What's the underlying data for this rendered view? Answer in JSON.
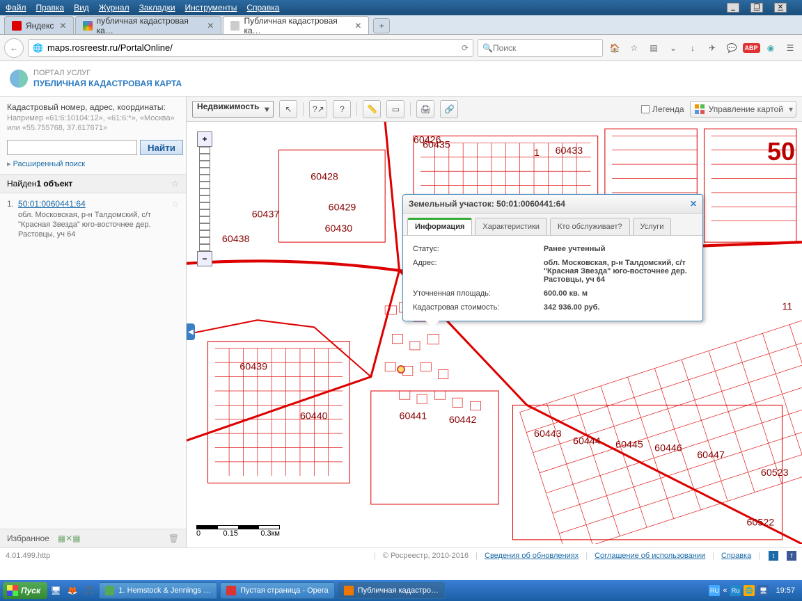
{
  "menu": {
    "file": "Файл",
    "edit": "Правка",
    "view": "Вид",
    "history": "Журнал",
    "bookmarks": "Закладки",
    "tools": "Инструменты",
    "help": "Справка"
  },
  "tabs": {
    "t1": "Яндекс",
    "t2": "публичная кадастровая ка…",
    "t3": "Публичная кадастровая ка…"
  },
  "url": "maps.rosreestr.ru/PortalOnline/",
  "search_placeholder": "Поиск",
  "portal": {
    "t1": "ПОРТАЛ УСЛУГ",
    "t2": "ПУБЛИЧНАЯ КАДАСТРОВАЯ КАРТА"
  },
  "sidebar": {
    "heading": "Кадастровый номер, адрес, координаты:",
    "hint": "Например «61:6:10104:12», «61:6:*», «Москва» или «55.755768, 37.617671»",
    "find": "Найти",
    "ext": "Расширенный поиск",
    "found_prefix": "Найден ",
    "found_count": "1 объект",
    "result": {
      "num": "1.",
      "cad": "50:01:0060441:64",
      "addr": "обл. Московская, р-н Талдомский, с/т \"Красная Звезда\" юго-восточнее дер. Растовцы, уч 64"
    },
    "fav": "Избранное"
  },
  "toolbar": {
    "realty": "Недвижимость",
    "legend": "Легенда",
    "manage": "Управление картой"
  },
  "bignum": "50",
  "callout": {
    "title": "Земельный участок: 50:01:0060441:64",
    "tab_info": "Информация",
    "tab_char": "Характеристики",
    "tab_who": "Кто обслуживает?",
    "tab_serv": "Услуги",
    "rows": {
      "status_k": "Статус:",
      "status_v": "Ранее учтенный",
      "addr_k": "Адрес:",
      "addr_v": "обл. Московская, р-н Талдомский, с/т \"Красная Звезда\" юго-восточнее дер. Растовцы, уч 64",
      "area_k": "Уточненная площадь:",
      "area_v": "600.00 кв. м",
      "cost_k": "Кадастровая стоимость:",
      "cost_v": "342 936.00 руб."
    }
  },
  "scale": {
    "a": "0",
    "b": "0.15",
    "c": "0.3км"
  },
  "map_labels": {
    "l60426": "60426",
    "l60428": "60428",
    "l60429": "60429",
    "l60430": "60430",
    "l60433": "60433",
    "l60435": "60435",
    "l60437": "60437",
    "l60438": "60438",
    "l60439": "60439",
    "l60440": "60440",
    "l60441": "60441",
    "l60442": "60442",
    "l60443": "60443",
    "l60444": "60444",
    "l60445": "60445",
    "l60446": "60446",
    "l60447": "60447",
    "l60522": "60522",
    "l60523": "60523",
    "ln1": "1",
    "ln11": "11"
  },
  "footer": {
    "ver": "4.01.499.http",
    "copy": "© Росреестр, 2010-2016",
    "upd": "Сведения об обновлениях",
    "terms": "Соглашение об использовании",
    "help": "Справка"
  },
  "tasks": {
    "start": "Пуск",
    "t1": "1. Hemstock & Jennings …",
    "t2": "Пустая страница - Opera",
    "t3": "Публичная кадастро…"
  },
  "clock": "19:57"
}
